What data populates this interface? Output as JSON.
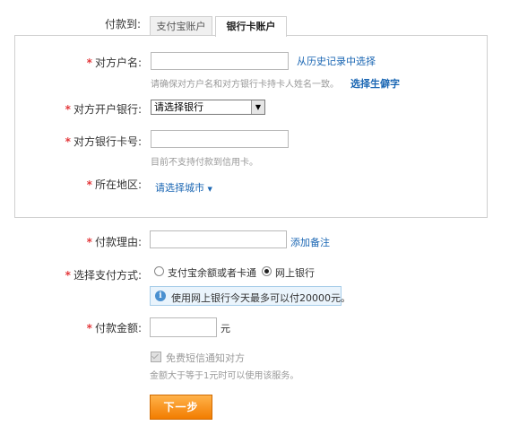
{
  "payment_to": {
    "label": "付款到:",
    "tabs": [
      {
        "label": "支付宝账户",
        "active": false
      },
      {
        "label": "银行卡账户",
        "active": true
      }
    ]
  },
  "required_mark": "*",
  "account_name": {
    "label": "对方户名:",
    "value": "",
    "history_link": "从历史记录中选择",
    "hint": "请确保对方户名和对方银行卡持卡人姓名一致。",
    "rare_char_link": "选择生僻字"
  },
  "bank": {
    "label": "对方开户银行:",
    "selected": "请选择银行"
  },
  "card_number": {
    "label": "对方银行卡号:",
    "value": "",
    "hint": "目前不支持付款到信用卡。"
  },
  "region": {
    "label": "所在地区:",
    "select_link": "请选择城市"
  },
  "reason": {
    "label": "付款理由:",
    "value": "",
    "add_note_link": "添加备注"
  },
  "payment_method": {
    "label": "选择支付方式:",
    "options": [
      {
        "label": "支付宝余额或者卡通",
        "checked": false
      },
      {
        "label": "网上银行",
        "checked": true
      }
    ],
    "info": "使用网上银行今天最多可以付20000元。"
  },
  "amount": {
    "label": "付款金额:",
    "value": "",
    "unit": "元"
  },
  "sms_notify": {
    "label": "免费短信通知对方",
    "hint": "金额大于等于1元时可以使用该服务。"
  },
  "next_button": "下一步",
  "colors": {
    "required": "#e4393c",
    "link": "#1a66b3",
    "button": "#f27d00",
    "info_bg": "#eaf4fc"
  },
  "icons": {
    "info": "info-icon",
    "dropdown": "triangle-down-icon"
  }
}
